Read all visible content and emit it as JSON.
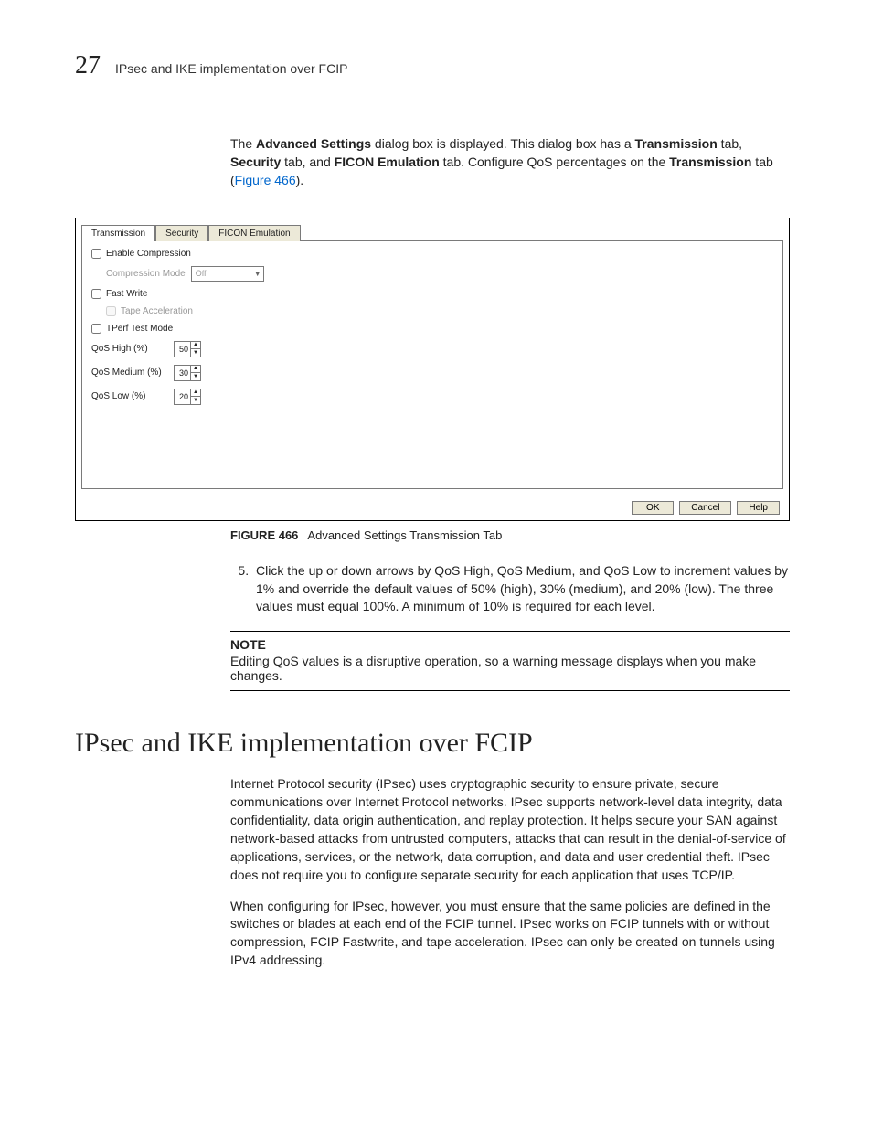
{
  "runhead": {
    "chapter_number": "27",
    "chapter_title": "IPsec and IKE implementation over FCIP"
  },
  "intro": {
    "before1": "The ",
    "b1": "Advanced Settings",
    "mid1": " dialog box is displayed. This dialog box has a ",
    "b2": "Transmission",
    "mid2": " tab, ",
    "b3": "Security",
    "mid3": " tab, and ",
    "b4": "FICON Emulation",
    "mid4": " tab. Configure QoS percentages on the ",
    "b5": "Transmission",
    "mid5": " tab (",
    "link": "Figure 466",
    "after": ")."
  },
  "dialog": {
    "tabs": {
      "transmission": "Transmission",
      "security": "Security",
      "ficon": "FICON Emulation"
    },
    "enable_compression": "Enable Compression",
    "compression_mode_label": "Compression Mode",
    "compression_mode_value": "Off",
    "fast_write": "Fast Write",
    "tape_accel": "Tape Acceleration",
    "tperf": "TPerf Test Mode",
    "qos_high_label": "QoS High (%)",
    "qos_high_value": "50",
    "qos_med_label": "QoS Medium (%)",
    "qos_med_value": "30",
    "qos_low_label": "QoS Low (%)",
    "qos_low_value": "20",
    "buttons": {
      "ok": "OK",
      "cancel": "Cancel",
      "help": "Help"
    }
  },
  "figure": {
    "label": "FIGURE 466",
    "caption": "Advanced Settings Transmission Tab"
  },
  "step5": {
    "text": "Click the up or down arrows by QoS High, QoS Medium, and QoS Low to increment values by 1% and override the default values of 50% (high), 30% (medium), and 20% (low). The three values must equal 100%. A minimum of 10% is required for each level."
  },
  "note": {
    "label": "NOTE",
    "body": "Editing QoS values is a disruptive operation, so a warning message displays when you make changes."
  },
  "h1": "IPsec and IKE implementation over FCIP",
  "para1": "Internet Protocol security (IPsec) uses cryptographic security to ensure private, secure communications over Internet Protocol networks. IPsec supports network-level data integrity, data confidentiality, data origin authentication, and replay protection. It helps secure your SAN against network-based attacks from untrusted computers, attacks that can result in the denial-of-service of applications, services, or the network, data corruption, and data and user credential theft. IPsec does not require you to configure separate security for each application that uses TCP/IP.",
  "para2": "When configuring for IPsec, however, you must ensure that the same policies are defined in the switches or blades at each end of the FCIP tunnel. IPsec works on FCIP tunnels with or without compression, FCIP Fastwrite, and tape acceleration. IPsec can only be created on tunnels using IPv4 addressing."
}
